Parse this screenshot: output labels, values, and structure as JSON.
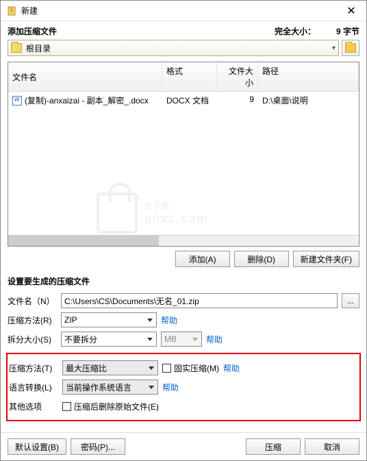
{
  "window": {
    "title": "新建"
  },
  "topSection": {
    "label": "添加压缩文件",
    "sizeLabel": "完全大小：",
    "sizeValue": "9 字节",
    "rootPath": "根目录"
  },
  "fileList": {
    "headers": {
      "name": "文件名",
      "format": "格式",
      "size": "文件大小",
      "path": "路径"
    },
    "rows": [
      {
        "name": "(复制)-anxaizai - 副本_解密_.docx",
        "format": "DOCX 文档",
        "size": "9",
        "path": "D:\\桌面\\说明"
      }
    ]
  },
  "listButtons": {
    "add": "添加(A)",
    "delete": "删除(D)",
    "newFolder": "新建文件夹(F)"
  },
  "settingsTitle": "设置要生成的压缩文件",
  "form": {
    "filenameLabel": "文件名（N）",
    "filenameValue": "C:\\Users\\CS\\Documents\\无名_01.zip",
    "browseBtn": "...",
    "method1Label": "压缩方法(R)",
    "method1Value": "ZIP",
    "splitLabel": "拆分大小(S)",
    "splitValue": "不要拆分",
    "splitUnit": "MB",
    "helpLink": "帮助",
    "method2Label": "压缩方法(T)",
    "method2Value": "最大压缩比",
    "solidLabel": "固实压缩(M)",
    "langLabel": "语言转换(L)",
    "langValue": "当前操作系统语言",
    "otherLabel": "其他选项",
    "deleteAfterLabel": "压缩后删除原始文件(E)"
  },
  "bottom": {
    "defaults": "默认设置(B)",
    "password": "密码(P)...",
    "compress": "压缩",
    "cancel": "取消"
  }
}
